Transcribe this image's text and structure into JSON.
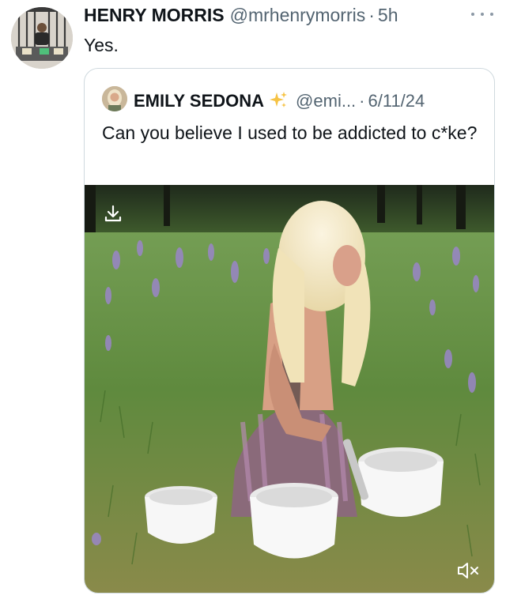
{
  "tweet": {
    "author_name": "HENRY MORRIS",
    "author_handle": "@mrhenrymorris",
    "separator": "·",
    "time": "5h",
    "text": "Yes.",
    "avatar_icon": "user-avatar-photo",
    "more_icon": "more-horizontal-icon"
  },
  "quoted_tweet": {
    "author_name": "EMILY SEDONA",
    "badge_icon": "sparkles-icon",
    "author_handle": "@emi...",
    "separator": "·",
    "date": "6/11/24",
    "text": "Can you believe I used to be addicted to c*ke?",
    "media": {
      "type": "video",
      "download_icon": "download-icon",
      "mute_icon": "muted-speaker-icon"
    }
  },
  "colors": {
    "primary_text": "#0f1419",
    "secondary_text": "#536471",
    "border": "#cfd9de",
    "background": "#ffffff"
  }
}
